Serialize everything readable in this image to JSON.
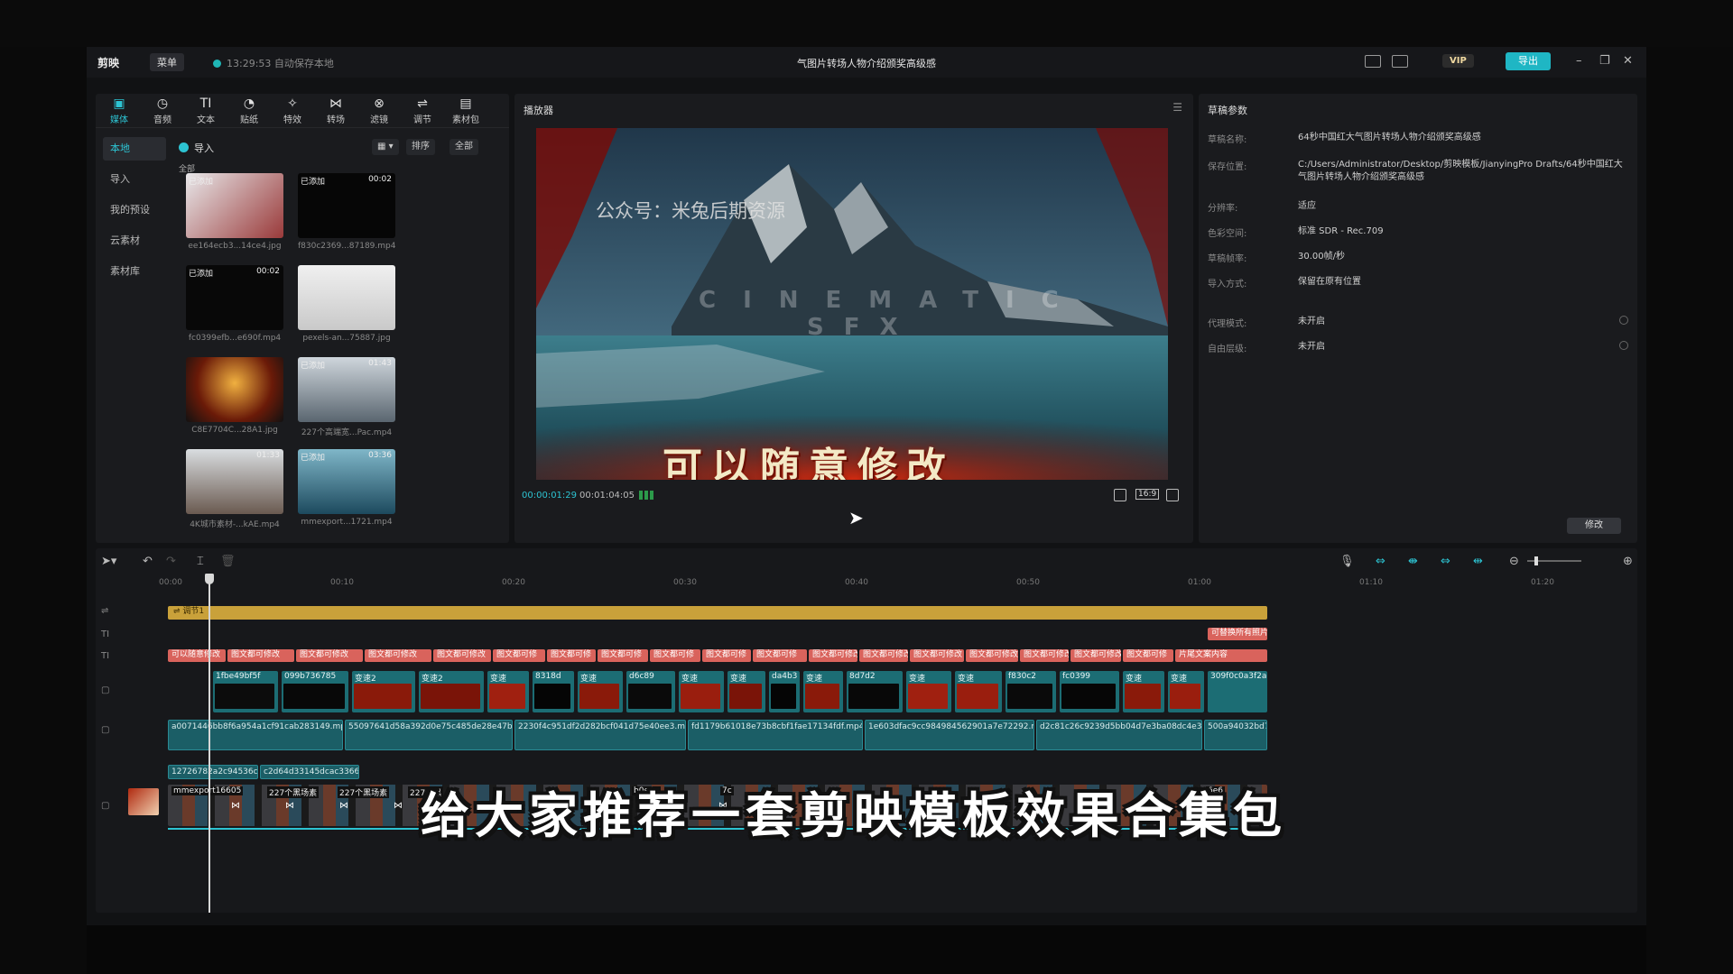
{
  "app": {
    "logo": "剪映",
    "menu_label": "菜单",
    "autosave": "13:29:53 自动保存本地",
    "project_title": "气图片转场人物介绍颁奖高级感",
    "vip": "VIP",
    "export": "导出"
  },
  "media_tools": [
    {
      "icon": "▣",
      "label": "媒体"
    },
    {
      "icon": "◷",
      "label": "音频"
    },
    {
      "icon": "TI",
      "label": "文本"
    },
    {
      "icon": "◔",
      "label": "贴纸"
    },
    {
      "icon": "✧",
      "label": "特效"
    },
    {
      "icon": "⋈",
      "label": "转场"
    },
    {
      "icon": "⊗",
      "label": "滤镜"
    },
    {
      "icon": "⇌",
      "label": "调节"
    },
    {
      "icon": "▤",
      "label": "素材包"
    }
  ],
  "sidebar": [
    "本地",
    "导入",
    "我的预设",
    "云素材",
    "素材库"
  ],
  "media": {
    "import_label": "导入",
    "sort_label": "排序",
    "filter_label": "全部",
    "all_label": "全部",
    "items": [
      {
        "tag": "已添加",
        "dur": "",
        "caption": "ee164ecb3...14ce4.jpg"
      },
      {
        "tag": "已添加",
        "dur": "00:02",
        "caption": "f830c2369...87189.mp4"
      },
      {
        "tag": "已添加",
        "dur": "00:02",
        "caption": "fc0399efb...e690f.mp4"
      },
      {
        "tag": "",
        "dur": "",
        "caption": "pexels-an...75887.jpg"
      },
      {
        "tag": "",
        "dur": "",
        "caption": "C8E7704C...28A1.jpg"
      },
      {
        "tag": "已添加",
        "dur": "01:43",
        "caption": "227个高端宽...Pac.mp4"
      },
      {
        "tag": "",
        "dur": "01:33",
        "caption": "4K城市素材-...kAE.mp4"
      },
      {
        "tag": "已添加",
        "dur": "03:36",
        "caption": "mmexport...1721.mp4"
      }
    ]
  },
  "player": {
    "header": "播放器",
    "watermark": "公众号：米兔后期资源",
    "subtitle": "可以随意修改",
    "cinematic": "CINEMATIC",
    "sfx": "SFX",
    "current_time": "00:00:01:29",
    "total_time": "00:01:04:05",
    "ratio": "16:9"
  },
  "props": {
    "header": "草稿参数",
    "rows": [
      {
        "k": "草稿名称:",
        "v": "64秒中国红大气图片转场人物介绍颁奖高级感"
      },
      {
        "k": "保存位置:",
        "v": "C:/Users/Administrator/Desktop/剪映模板/JianyingPro Drafts/64秒中国红大气图片转场人物介绍颁奖高级感"
      },
      {
        "k": "分辨率:",
        "v": "适应"
      },
      {
        "k": "色彩空间:",
        "v": "标准 SDR - Rec.709"
      },
      {
        "k": "草稿帧率:",
        "v": "30.00帧/秒"
      },
      {
        "k": "导入方式:",
        "v": "保留在原有位置"
      },
      {
        "k": "代理模式:",
        "v": "未开启"
      },
      {
        "k": "自由层级:",
        "v": "未开启"
      }
    ],
    "modify": "修改"
  },
  "timeline": {
    "ruler": [
      "00:00",
      "00:10",
      "00:20",
      "00:30",
      "00:40",
      "00:50",
      "01:00",
      "01:10",
      "01:20"
    ],
    "adjust_label": "调节1",
    "text_top": "可替换所有照片",
    "text_clips": [
      "可以随意修改",
      "图文都可修改",
      "图文都可修改",
      "图文都可修改",
      "图文都可修改",
      "图文都可修",
      "图文都可修",
      "图文都可修",
      "图文都可修",
      "图文都可修",
      "图文都可修",
      "图文都可修改",
      "图文都可修改",
      "图文都可修改",
      "图文都可修改",
      "图文都可修改",
      "图文都可修改",
      "图文都可修",
      "片尾文案内容"
    ],
    "video_clips": [
      "1fbe49bf5f",
      "099b736785",
      "变速2",
      "变速2",
      "变速",
      "8318d",
      "变速",
      "d6c89",
      "变速",
      "变速",
      "da4b3",
      "变速",
      "8d7d2",
      "变速",
      "变速",
      "f830c2",
      "fc0399",
      "变速",
      "变速",
      "309f0c0a3f2a71"
    ],
    "long_clips": [
      "a0071446bb8f6a954a1cf91cab283149.mp4",
      "55097641d58a392d0e75c485de28e47b.mp",
      "2230f4c951df2d282bcf041d75e40ee3.mp4",
      "fd1179b61018e73b8cbf1fae17134fdf.mp4",
      "1e603dfac9cc984984562901a7e72292.mp",
      "d2c81c26c9239d5bb04d7e3ba08dc4e3.mp",
      "500a94032bd720"
    ],
    "bottom_clips": [
      "12726782a2c94536c033ec8b",
      "c2d64d33145dcac3366ad0ff1"
    ],
    "main_clips": [
      "mmexport16605",
      "227个黑场素",
      "227个黑场素",
      "227个黑",
      "b0e0e",
      "7c",
      "6e6"
    ],
    "caption": "给大家推荐一套剪映模板效果合集包"
  },
  "colors": {
    "accent": "#2dc3d2",
    "adjust": "#c9a13a",
    "text_clip": "#d9635c",
    "video_clip": "#1c6d74"
  }
}
